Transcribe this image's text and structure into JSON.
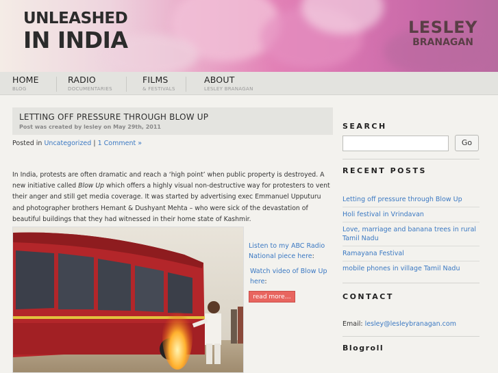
{
  "header": {
    "title_line1": "UNLEASHED",
    "title_line2": "IN INDIA",
    "author_first": "LESLEY",
    "author_last": "BRANAGAN"
  },
  "nav": [
    {
      "title": "HOME",
      "sub": "BLOG"
    },
    {
      "title": "RADIO",
      "sub": "DOCUMENTARIES"
    },
    {
      "title": "FILMS",
      "sub": "& FESTIVALS"
    },
    {
      "title": "ABOUT",
      "sub": "LESLEY BRANAGAN"
    }
  ],
  "post": {
    "title": "LETTING OFF PRESSURE THROUGH BLOW UP",
    "meta": "Post was created by lesley on May 29th, 2011",
    "posted_in_prefix": "Posted in",
    "category": "Uncategorized",
    "separator": "|",
    "comments": "1 Comment »",
    "body_part1": "In India, protests are often dramatic and reach a ‘high point’ when public property is destroyed. A new initiative called",
    "body_em": "Blow Up",
    "body_part2": "which offers a highly visual non-destructive way for protesters to vent their anger and still get media coverage. It was started by advertising exec Emmanuel Upputuru and photographer brothers Hemant & Dushyant Mehta – who were sick of the devastation of beautiful buildings that they had witnessed in their home state of Kashmir.",
    "listen_link": "Listen to my ABC Radio National piece here",
    "listen_suffix": ":",
    "watch_link": "Watch video of Blow Up here",
    "watch_suffix": ":",
    "read_more": "read more…"
  },
  "sidebar": {
    "search_heading": "SEARCH",
    "search_value": "",
    "search_button": "Go",
    "recent_heading": "RECENT POSTS",
    "recent_posts": [
      "Letting off pressure through Blow Up",
      "Holi festival in Vrindavan",
      "Love, marriage and banana trees in rural Tamil Nadu",
      "Ramayana Festival",
      "mobile phones in village Tamil Nadu"
    ],
    "contact_heading": "CONTACT",
    "contact_label": "Email:",
    "contact_email": "lesley@lesleybranagan.com",
    "blogroll_heading": "Blogroll"
  },
  "colors": {
    "link": "#3a78c2",
    "read_more_bg": "#e8655f",
    "header_pink": "#e281b6"
  }
}
